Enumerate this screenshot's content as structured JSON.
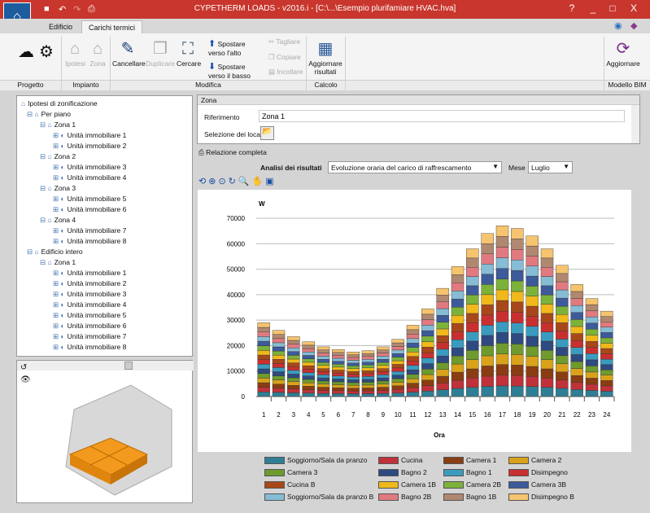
{
  "window": {
    "title": "CYPETHERM LOADS - v2016.i - [C:\\...\\Esempio plurifamiare HVAC.hva]",
    "help": "?",
    "minimize": "_",
    "maximize": "□",
    "close": "X"
  },
  "tabs": [
    {
      "label": "Edificio",
      "active": false
    },
    {
      "label": "Carichi termici",
      "active": true
    }
  ],
  "ribbon": {
    "buttons": {
      "ipotesi": "Ipotesi",
      "zona": "Zona",
      "cancellare": "Cancellare",
      "duplicare": "Duplicare",
      "cercare": "Cercare",
      "su": "Spostare verso l'alto",
      "giu": "Spostare verso il basso",
      "tagliare": "Tagliare",
      "copiare": "Copiare",
      "incollare": "Incollare",
      "aggiornare_risultati": "Aggiornare risultati",
      "aggiornare": "Aggiornare"
    },
    "groups": {
      "progetto": "Progetto",
      "impianto": "Impianto",
      "modifica": "Modifica",
      "calcolo": "Calcolo",
      "bim": "Modello BIM"
    }
  },
  "tree": {
    "root": "Ipotesi di zonificazione",
    "items": [
      {
        "label": "Per piano",
        "level": 1
      },
      {
        "label": "Zona 1",
        "level": 2
      },
      {
        "label": "Unità immobiliare 1",
        "level": 3
      },
      {
        "label": "Unità immobiliare 2",
        "level": 3
      },
      {
        "label": "Zona 2",
        "level": 2
      },
      {
        "label": "Unità immobiliare 3",
        "level": 3
      },
      {
        "label": "Unità immobiliare 4",
        "level": 3
      },
      {
        "label": "Zona 3",
        "level": 2
      },
      {
        "label": "Unità immobiliare 5",
        "level": 3
      },
      {
        "label": "Unità immobiliare 6",
        "level": 3
      },
      {
        "label": "Zona 4",
        "level": 2
      },
      {
        "label": "Unità immobiliare 7",
        "level": 3
      },
      {
        "label": "Unità immobiliare 8",
        "level": 3
      },
      {
        "label": "Edificio intero",
        "level": 1
      },
      {
        "label": "Zona 1",
        "level": 2
      },
      {
        "label": "Unità immobiliare 1",
        "level": 3
      },
      {
        "label": "Unità immobiliare 2",
        "level": 3
      },
      {
        "label": "Unità immobiliare 3",
        "level": 3
      },
      {
        "label": "Unità immobiliare 4",
        "level": 3
      },
      {
        "label": "Unità immobiliare 5",
        "level": 3
      },
      {
        "label": "Unità immobiliare 6",
        "level": 3
      },
      {
        "label": "Unità immobiliare 7",
        "level": 3
      },
      {
        "label": "Unità immobiliare 8",
        "level": 3
      }
    ]
  },
  "zona": {
    "header": "Zona",
    "riferimento_label": "Riferimento",
    "riferimento_value": "Zona 1",
    "selezione_label": "Selezione dei locali"
  },
  "report": {
    "label": "Relazione completa"
  },
  "analysis": {
    "label": "Analisi dei risultati",
    "value": "Evoluzione oraria del carico di raffrescamento",
    "mese_label": "Mese",
    "mese_value": "Luglio"
  },
  "chart_data": {
    "type": "bar",
    "stacked": true,
    "ylabel": "W",
    "xlabel": "Ora",
    "ylim": [
      0,
      70000
    ],
    "yticks": [
      0,
      10000,
      20000,
      30000,
      40000,
      50000,
      60000,
      70000
    ],
    "grid": true,
    "legend": "bottom",
    "categories": [
      "1",
      "2",
      "3",
      "4",
      "5",
      "6",
      "7",
      "8",
      "9",
      "10",
      "11",
      "12",
      "13",
      "14",
      "15",
      "16",
      "17",
      "18",
      "19",
      "20",
      "21",
      "22",
      "23",
      "24"
    ],
    "series": [
      {
        "name": "Soggiorno/Sala da pranzo",
        "color": "#2e7f96",
        "values": [
          1810,
          1625,
          1470,
          1345,
          1220,
          1155,
          1095,
          1125,
          1220,
          1405,
          1750,
          2155,
          2655,
          3190,
          3625,
          4000,
          4190,
          4125,
          3940,
          3625,
          3220,
          2750,
          2405,
          2095
        ]
      },
      {
        "name": "Cucina",
        "color": "#c0323a",
        "values": [
          1810,
          1625,
          1470,
          1345,
          1220,
          1155,
          1095,
          1125,
          1220,
          1405,
          1750,
          2155,
          2655,
          3190,
          3625,
          4000,
          4190,
          4125,
          3940,
          3625,
          3220,
          2750,
          2405,
          2095
        ]
      },
      {
        "name": "Camera 1",
        "color": "#8a3d12",
        "values": [
          1810,
          1625,
          1470,
          1345,
          1220,
          1155,
          1095,
          1125,
          1220,
          1405,
          1750,
          2155,
          2655,
          3190,
          3625,
          4000,
          4190,
          4125,
          3940,
          3625,
          3220,
          2750,
          2405,
          2095
        ]
      },
      {
        "name": "Camera 2",
        "color": "#d9a21a",
        "values": [
          1810,
          1625,
          1470,
          1345,
          1220,
          1155,
          1095,
          1125,
          1220,
          1405,
          1750,
          2155,
          2655,
          3190,
          3625,
          4000,
          4190,
          4125,
          3940,
          3625,
          3220,
          2750,
          2405,
          2095
        ]
      },
      {
        "name": "Camera 3",
        "color": "#6e9a2e",
        "values": [
          1810,
          1625,
          1470,
          1345,
          1220,
          1155,
          1095,
          1125,
          1220,
          1405,
          1750,
          2155,
          2655,
          3190,
          3625,
          4000,
          4190,
          4125,
          3940,
          3625,
          3220,
          2750,
          2405,
          2095
        ]
      },
      {
        "name": "Bagno 2",
        "color": "#2f4a80",
        "values": [
          1810,
          1625,
          1470,
          1345,
          1220,
          1155,
          1095,
          1125,
          1220,
          1405,
          1750,
          2155,
          2655,
          3190,
          3625,
          4000,
          4190,
          4125,
          3940,
          3625,
          3220,
          2750,
          2405,
          2095
        ]
      },
      {
        "name": "Bagno 1",
        "color": "#3a9bbf",
        "values": [
          1810,
          1625,
          1470,
          1345,
          1220,
          1155,
          1095,
          1125,
          1220,
          1405,
          1750,
          2155,
          2655,
          3190,
          3625,
          4000,
          4190,
          4125,
          3940,
          3625,
          3220,
          2750,
          2405,
          2095
        ]
      },
      {
        "name": "Disimpegno",
        "color": "#c83030",
        "values": [
          1810,
          1625,
          1470,
          1345,
          1220,
          1155,
          1095,
          1125,
          1220,
          1405,
          1750,
          2155,
          2655,
          3190,
          3625,
          4000,
          4190,
          4125,
          3940,
          3625,
          3220,
          2750,
          2405,
          2095
        ]
      },
      {
        "name": "Cucina B",
        "color": "#a8481a",
        "values": [
          1810,
          1625,
          1470,
          1345,
          1220,
          1155,
          1095,
          1125,
          1220,
          1405,
          1750,
          2155,
          2655,
          3190,
          3625,
          4000,
          4190,
          4125,
          3940,
          3625,
          3220,
          2750,
          2405,
          2095
        ]
      },
      {
        "name": "Camera 1B",
        "color": "#f0b81a",
        "values": [
          1810,
          1625,
          1470,
          1345,
          1220,
          1155,
          1095,
          1125,
          1220,
          1405,
          1750,
          2155,
          2655,
          3190,
          3625,
          4000,
          4190,
          4125,
          3940,
          3625,
          3220,
          2750,
          2405,
          2095
        ]
      },
      {
        "name": "Camera 2B",
        "color": "#7cb23a",
        "values": [
          1810,
          1625,
          1470,
          1345,
          1220,
          1155,
          1095,
          1125,
          1220,
          1405,
          1750,
          2155,
          2655,
          3190,
          3625,
          4000,
          4190,
          4125,
          3940,
          3625,
          3220,
          2750,
          2405,
          2095
        ]
      },
      {
        "name": "Camera 3B",
        "color": "#3d5a9a",
        "values": [
          1810,
          1625,
          1470,
          1345,
          1220,
          1155,
          1095,
          1125,
          1220,
          1405,
          1750,
          2155,
          2655,
          3190,
          3625,
          4000,
          4190,
          4125,
          3940,
          3625,
          3220,
          2750,
          2405,
          2095
        ]
      },
      {
        "name": "Soggiorno/Sala da pranzo B",
        "color": "#86bcd4",
        "values": [
          1810,
          1625,
          1470,
          1345,
          1220,
          1155,
          1095,
          1125,
          1220,
          1405,
          1750,
          2155,
          2655,
          3190,
          3625,
          4000,
          4190,
          4125,
          3940,
          3625,
          3220,
          2750,
          2405,
          2095
        ]
      },
      {
        "name": "Bagno 2B",
        "color": "#e07a80",
        "values": [
          1810,
          1625,
          1470,
          1345,
          1220,
          1155,
          1095,
          1125,
          1220,
          1405,
          1750,
          2155,
          2655,
          3190,
          3625,
          4000,
          4190,
          4125,
          3940,
          3625,
          3220,
          2750,
          2405,
          2095
        ]
      },
      {
        "name": "Bagno 1B",
        "color": "#b08870",
        "values": [
          1810,
          1625,
          1470,
          1345,
          1220,
          1155,
          1095,
          1125,
          1220,
          1405,
          1750,
          2155,
          2655,
          3190,
          3625,
          4000,
          4190,
          4125,
          3940,
          3625,
          3220,
          2750,
          2405,
          2095
        ]
      },
      {
        "name": "Disimpegno B",
        "color": "#f6c46e",
        "values": [
          1810,
          1625,
          1470,
          1345,
          1220,
          1155,
          1095,
          1125,
          1220,
          1405,
          1750,
          2155,
          2655,
          3190,
          3625,
          4000,
          4190,
          4125,
          3940,
          3625,
          3220,
          2750,
          2405,
          2095
        ]
      }
    ]
  }
}
